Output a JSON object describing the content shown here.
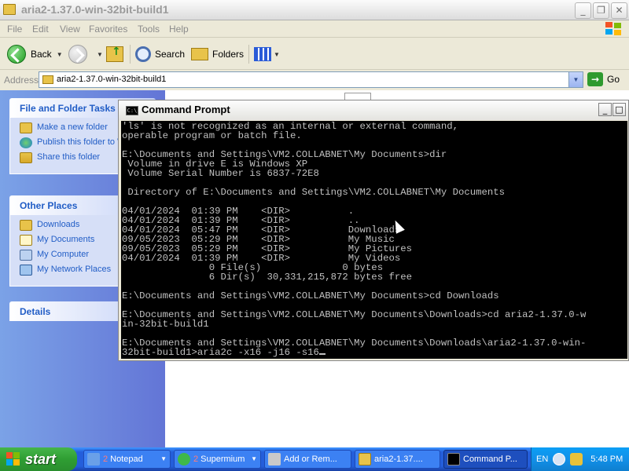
{
  "explorer": {
    "title": "aria2-1.37.0-win-32bit-build1",
    "menu": [
      "File",
      "Edit",
      "View",
      "Favorites",
      "Tools",
      "Help"
    ],
    "toolbar": {
      "back": "Back",
      "search": "Search",
      "folders": "Folders"
    },
    "address": {
      "label": "Address",
      "value": "aria2-1.37.0-win-32bit-build1",
      "go": "Go"
    },
    "caption_buttons": {
      "minimize": "_",
      "maximize": "❐",
      "close": "✕"
    }
  },
  "sidebar": {
    "tasks": {
      "title": "File and Folder Tasks",
      "items": [
        {
          "label": "Make a new folder",
          "icon": "new-folder-icon"
        },
        {
          "label": "Publish this folder to Web",
          "icon": "globe-icon"
        },
        {
          "label": "Share this folder",
          "icon": "share-icon"
        }
      ]
    },
    "places": {
      "title": "Other Places",
      "items": [
        {
          "label": "Downloads",
          "icon": "folder-icon"
        },
        {
          "label": "My Documents",
          "icon": "documents-icon"
        },
        {
          "label": "My Computer",
          "icon": "computer-icon"
        },
        {
          "label": "My Network Places",
          "icon": "network-icon"
        }
      ]
    },
    "details": {
      "title": "Details"
    }
  },
  "cmd": {
    "title": "Command Prompt",
    "lines": [
      "'ls' is not recognized as an internal or external command,",
      "operable program or batch file.",
      "",
      "E:\\Documents and Settings\\VM2.COLLABNET\\My Documents>dir",
      " Volume in drive E is Windows XP",
      " Volume Serial Number is 6837-72E8",
      "",
      " Directory of E:\\Documents and Settings\\VM2.COLLABNET\\My Documents",
      "",
      "04/01/2024  01:39 PM    <DIR>          .",
      "04/01/2024  01:39 PM    <DIR>          ..",
      "04/01/2024  05:47 PM    <DIR>          Downloads",
      "09/05/2023  05:29 PM    <DIR>          My Music",
      "09/05/2023  05:29 PM    <DIR>          My Pictures",
      "04/01/2024  01:39 PM    <DIR>          My Videos",
      "               0 File(s)              0 bytes",
      "               6 Dir(s)  30,331,215,872 bytes free",
      "",
      "E:\\Documents and Settings\\VM2.COLLABNET\\My Documents>cd Downloads",
      "",
      "E:\\Documents and Settings\\VM2.COLLABNET\\My Documents\\Downloads>cd aria2-1.37.0-w",
      "in-32bit-build1",
      "",
      "E:\\Documents and Settings\\VM2.COLLABNET\\My Documents\\Downloads\\aria2-1.37.0-win-",
      "32bit-build1>aria2c -x16 -j16 -s16"
    ]
  },
  "taskbar": {
    "start": "start",
    "tasks": [
      {
        "count": "2",
        "label": "Notepad",
        "arrow": "▼",
        "color": "#6aa0e8"
      },
      {
        "count": "2",
        "label": "Supermium",
        "arrow": "▼",
        "color": "#3fb84a"
      },
      {
        "count": "",
        "label": "Add or Rem...",
        "arrow": "",
        "color": "#c9c9c9"
      },
      {
        "count": "",
        "label": "aria2-1.37....",
        "arrow": "",
        "color": "#e8c34a"
      },
      {
        "count": "",
        "label": "Command P...",
        "arrow": "",
        "color": "#000000"
      }
    ],
    "tray": {
      "lang": "EN",
      "time": "5:48 PM"
    }
  }
}
